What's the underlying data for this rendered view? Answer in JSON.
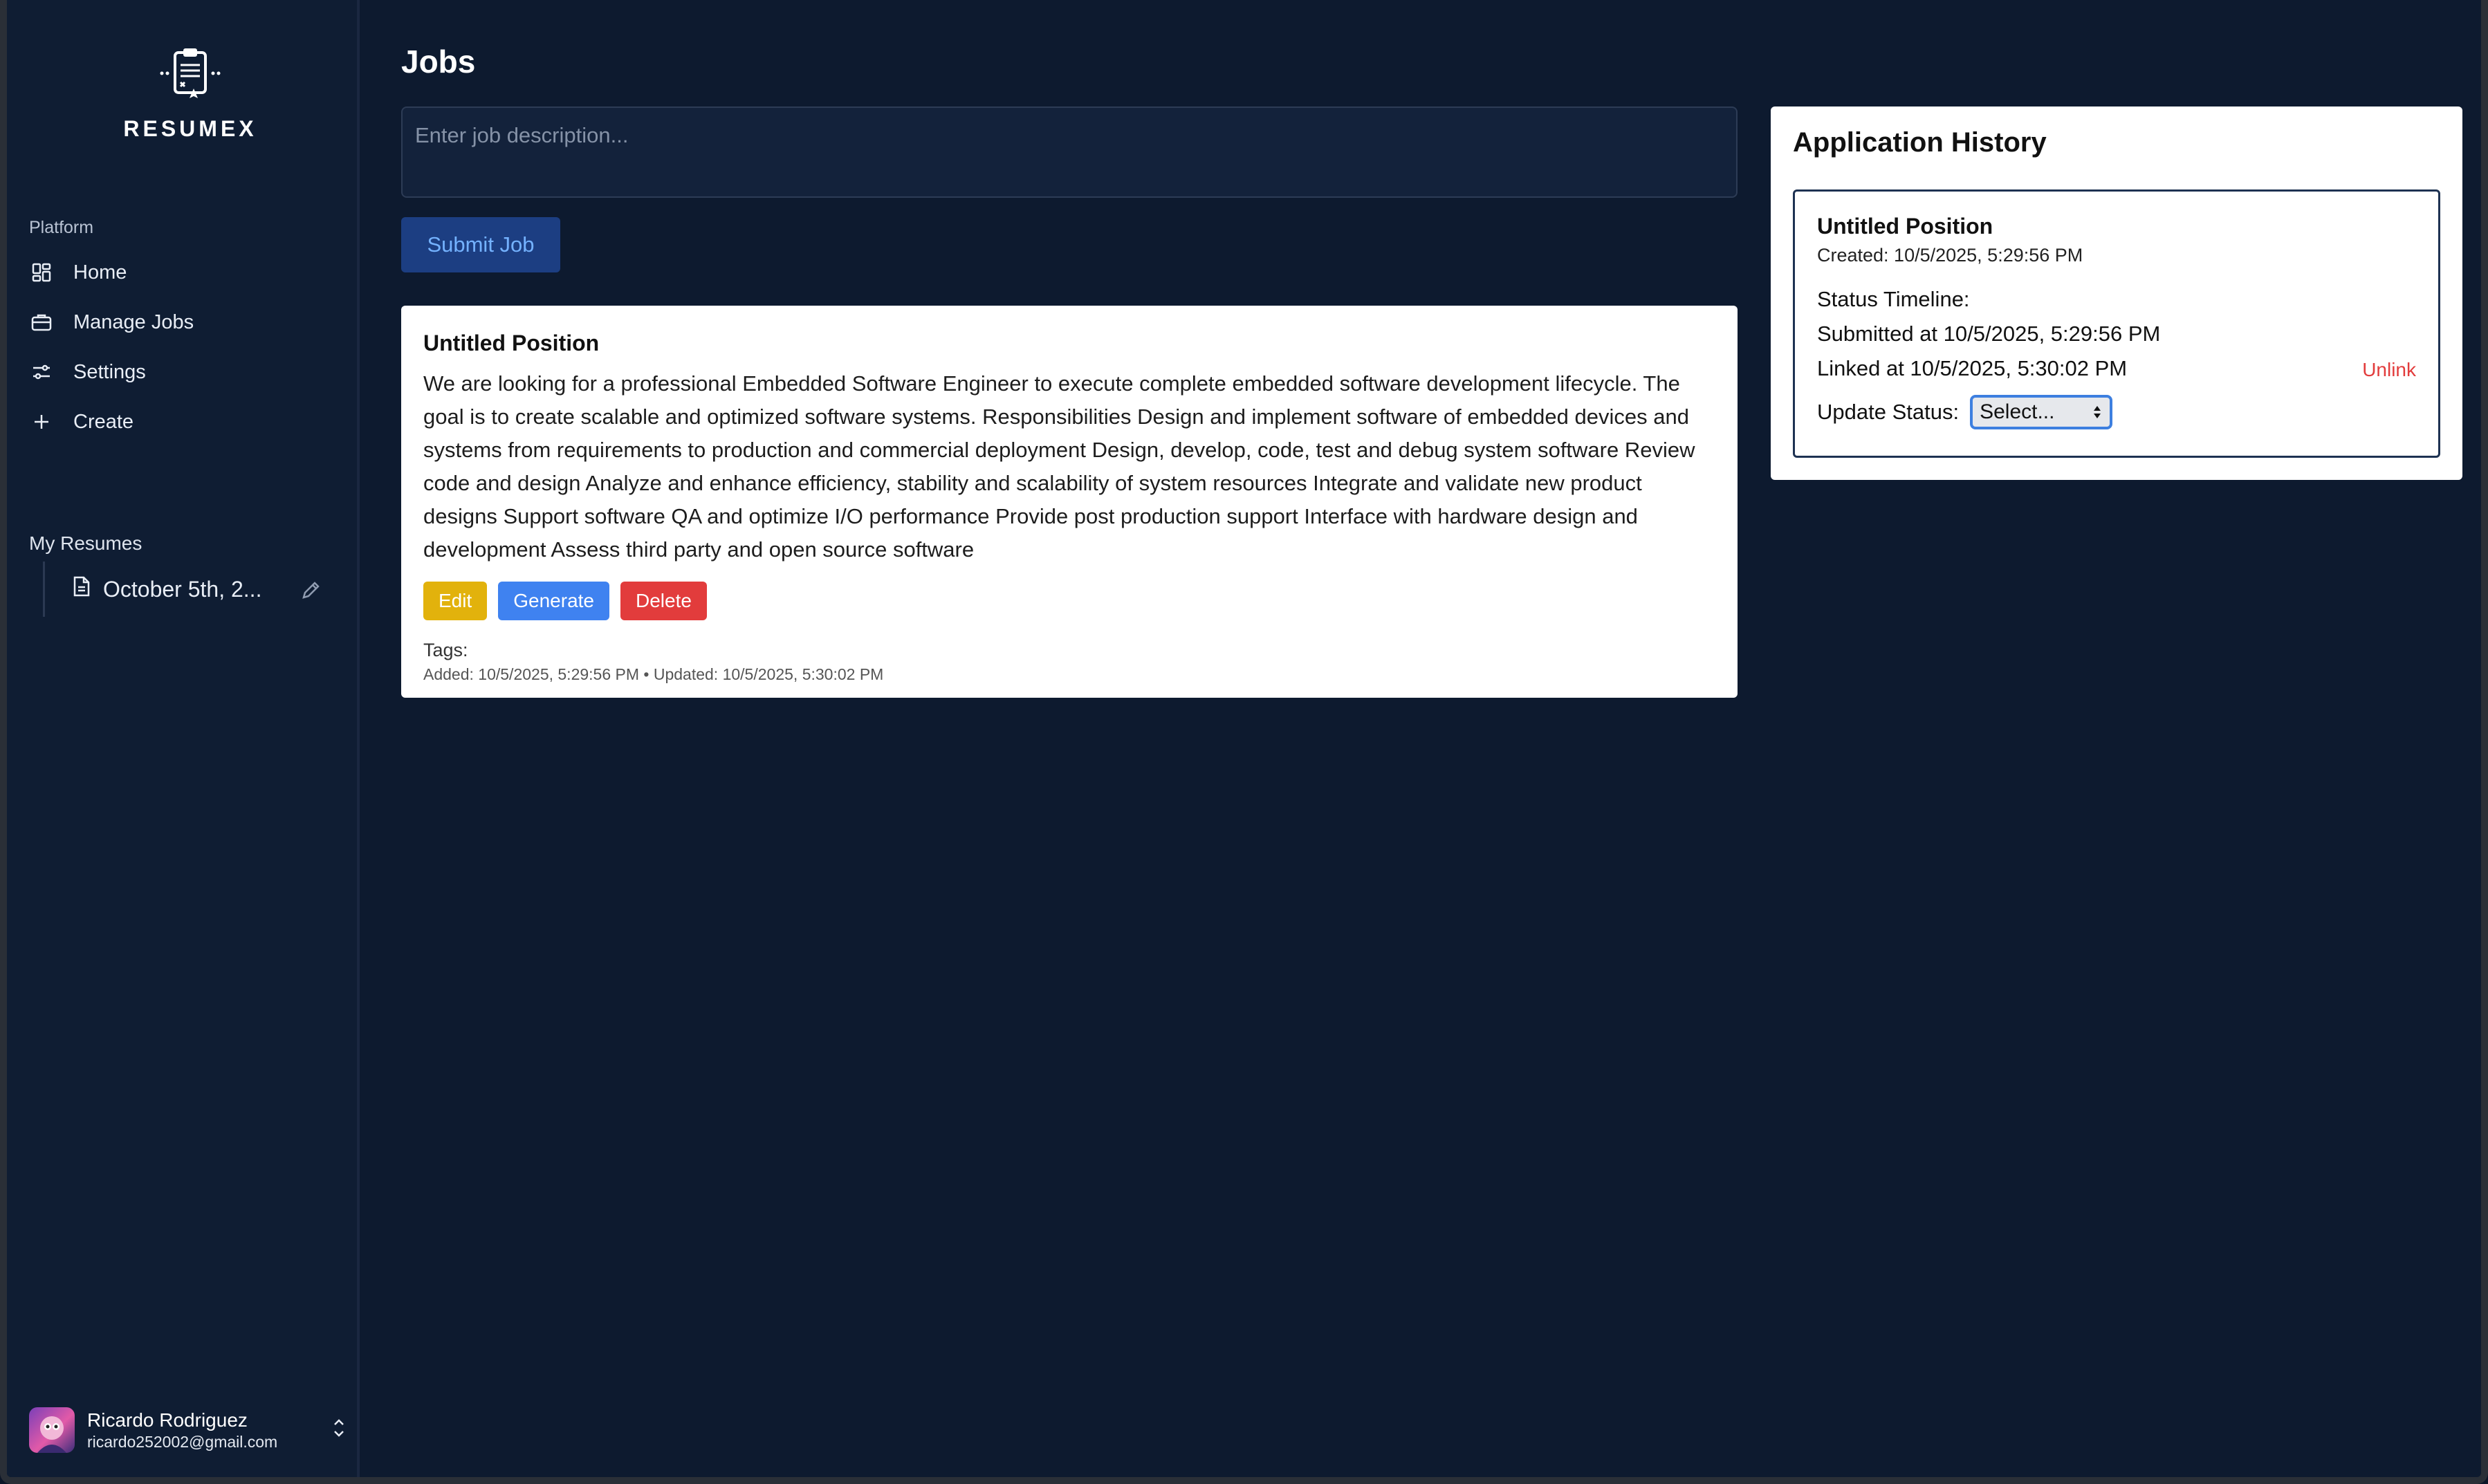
{
  "sidebar": {
    "brand": "RESUMEX",
    "platform_label": "Platform",
    "nav": [
      {
        "label": "Home",
        "icon": "grid-icon"
      },
      {
        "label": "Manage Jobs",
        "icon": "briefcase-icon"
      },
      {
        "label": "Settings",
        "icon": "sliders-icon"
      },
      {
        "label": "Create",
        "icon": "plus-icon"
      }
    ],
    "my_resumes_label": "My Resumes",
    "resumes": [
      {
        "label": "October 5th, 2..."
      }
    ],
    "user": {
      "name": "Ricardo Rodriguez",
      "email": "ricardo252002@gmail.com"
    }
  },
  "main": {
    "title": "Jobs",
    "job_input": {
      "placeholder": "Enter job description...",
      "value": ""
    },
    "submit_label": "Submit Job",
    "job_card": {
      "title": "Untitled Position",
      "description": "We are looking for a professional Embedded Software Engineer to execute complete embedded software development lifecycle. The goal is to create scalable and optimized software systems. Responsibilities Design and implement software of embedded devices and systems from requirements to production and commercial deployment Design, develop, code, test and debug system software Review code and design Analyze and enhance efficiency, stability and scalability of system resources Integrate and validate new product designs Support software QA and optimize I/O performance Provide post production support Interface with hardware design and development Assess third party and open source software",
      "edit_label": "Edit",
      "generate_label": "Generate",
      "delete_label": "Delete",
      "tags_label": "Tags:",
      "meta": "Added: 10/5/2025, 5:29:56 PM • Updated: 10/5/2025, 5:30:02 PM"
    }
  },
  "history": {
    "title": "Application History",
    "entry": {
      "position": "Untitled Position",
      "created": "Created: 10/5/2025, 5:29:56 PM",
      "timeline_label": "Status Timeline:",
      "submitted": "Submitted at 10/5/2025, 5:29:56 PM",
      "linked": "Linked at 10/5/2025, 5:30:02 PM",
      "unlink_label": "Unlink",
      "update_label": "Update Status:",
      "select_value": "Select..."
    }
  },
  "colors": {
    "background": "#0d1a2f",
    "sidebar": "#0f1d33",
    "accent": "#3f82f0",
    "edit": "#e2b20c",
    "delete": "#e23c3c"
  }
}
